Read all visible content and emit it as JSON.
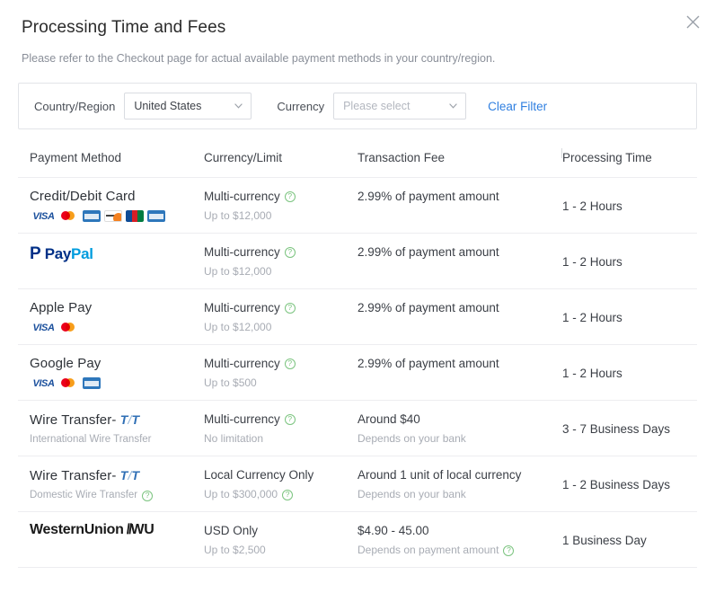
{
  "header": {
    "title": "Processing Time and Fees",
    "subtitle": "Please refer to the Checkout page for actual available payment methods in your country/region.",
    "close_label": "×"
  },
  "filter": {
    "country_label": "Country/Region",
    "country_value": "United States",
    "currency_label": "Currency",
    "currency_placeholder": "Please select",
    "currency_value": "Please select",
    "clear_label": "Clear Filter",
    "link_color": "#2f7fe0"
  },
  "table": {
    "columns": [
      "Payment Method",
      "Currency/Limit",
      "Transaction Fee",
      "Processing Time"
    ],
    "rows": [
      {
        "method": "Credit/Debit Card",
        "method_sub": "",
        "method_sub_help": false,
        "logos": [
          "visa",
          "mastercard",
          "amex",
          "discover",
          "jcb",
          "unionpay"
        ],
        "currency": "Multi-currency",
        "currency_help": true,
        "limit": "Up to $12,000",
        "limit_help": false,
        "fee": "2.99% of payment amount",
        "fee_sub": "",
        "fee_sub_help": false,
        "time": "1 - 2 Hours"
      },
      {
        "method": "",
        "method_logo": "paypal",
        "method_sub": "",
        "method_sub_help": false,
        "logos": [],
        "currency": "Multi-currency",
        "currency_help": true,
        "limit": "Up to $12,000",
        "limit_help": false,
        "fee": "2.99% of payment amount",
        "fee_sub": "",
        "fee_sub_help": false,
        "time": "1 - 2 Hours"
      },
      {
        "method": "Apple Pay",
        "method_sub": "",
        "method_sub_help": false,
        "logos": [
          "visa",
          "mastercard"
        ],
        "currency": "Multi-currency",
        "currency_help": true,
        "limit": "Up to $12,000",
        "limit_help": false,
        "fee": "2.99% of payment amount",
        "fee_sub": "",
        "fee_sub_help": false,
        "time": "1 - 2 Hours"
      },
      {
        "method": "Google Pay",
        "method_sub": "",
        "method_sub_help": false,
        "logos": [
          "visa",
          "mastercard",
          "amex"
        ],
        "currency": "Multi-currency",
        "currency_help": true,
        "limit": "Up to $500",
        "limit_help": false,
        "fee": "2.99% of payment amount",
        "fee_sub": "",
        "fee_sub_help": false,
        "time": "1 - 2 Hours"
      },
      {
        "method": "Wire Transfer-",
        "method_mark": "T/T",
        "method_sub": "International Wire Transfer",
        "method_sub_help": false,
        "logos": [],
        "currency": "Multi-currency",
        "currency_help": true,
        "limit": "No limitation",
        "limit_help": false,
        "fee": "Around $40",
        "fee_sub": "Depends on your bank",
        "fee_sub_help": false,
        "time": "3 - 7 Business Days"
      },
      {
        "method": "Wire Transfer-",
        "method_mark": "T/T",
        "method_sub": "Domestic Wire Transfer",
        "method_sub_help": true,
        "logos": [],
        "currency": "Local Currency Only",
        "currency_help": false,
        "limit": "Up to $300,000",
        "limit_help": true,
        "fee": "Around 1 unit of local currency",
        "fee_sub": "Depends on your bank",
        "fee_sub_help": false,
        "time": "1 - 2 Business Days"
      },
      {
        "method": "",
        "method_logo": "westernunion",
        "method_sub": "",
        "method_sub_help": false,
        "logos": [],
        "currency": "USD Only",
        "currency_help": false,
        "limit": "Up to $2,500",
        "limit_help": false,
        "fee": "$4.90 - 45.00",
        "fee_sub": "Depends on payment amount",
        "fee_sub_help": true,
        "time": "1 Business Day"
      }
    ]
  },
  "icons": {
    "help": "?",
    "westernunion_text": "WesternUnion",
    "westernunion_mark": "WU",
    "paypal_mark": "P",
    "paypal_word_a": "Pay",
    "paypal_word_b": "Pal",
    "visa_text": "VISA"
  }
}
